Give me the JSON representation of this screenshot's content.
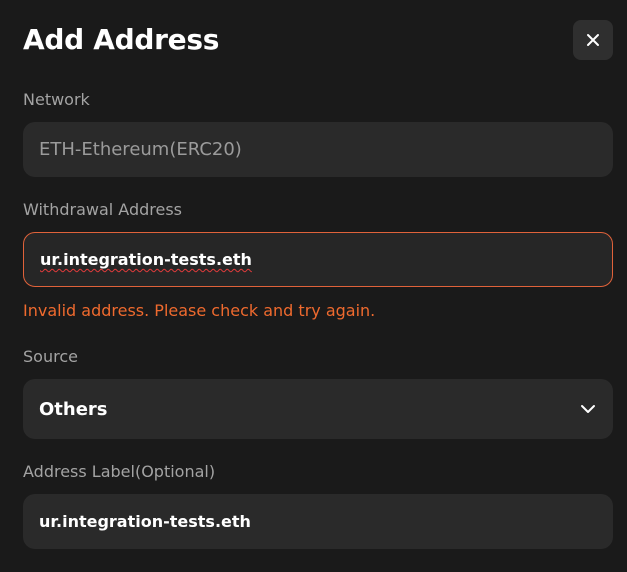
{
  "dialog": {
    "title": "Add Address",
    "close_label": "×"
  },
  "network": {
    "label": "Network",
    "value": "ETH-Ethereum(ERC20)"
  },
  "withdrawal": {
    "label": "Withdrawal Address",
    "value": "ur.integration-tests.eth",
    "error": "Invalid address. Please check and try again."
  },
  "source": {
    "label": "Source",
    "value": "Others"
  },
  "address_label": {
    "label": "Address Label(Optional)",
    "value": "ur.integration-tests.eth"
  },
  "colors": {
    "background": "#1a1a1a",
    "field": "#2a2a2a",
    "error": "#ef6a2e",
    "error_border": "#e0623a"
  },
  "icons": {
    "close": "close-icon",
    "dropdown": "chevron-down-icon"
  }
}
